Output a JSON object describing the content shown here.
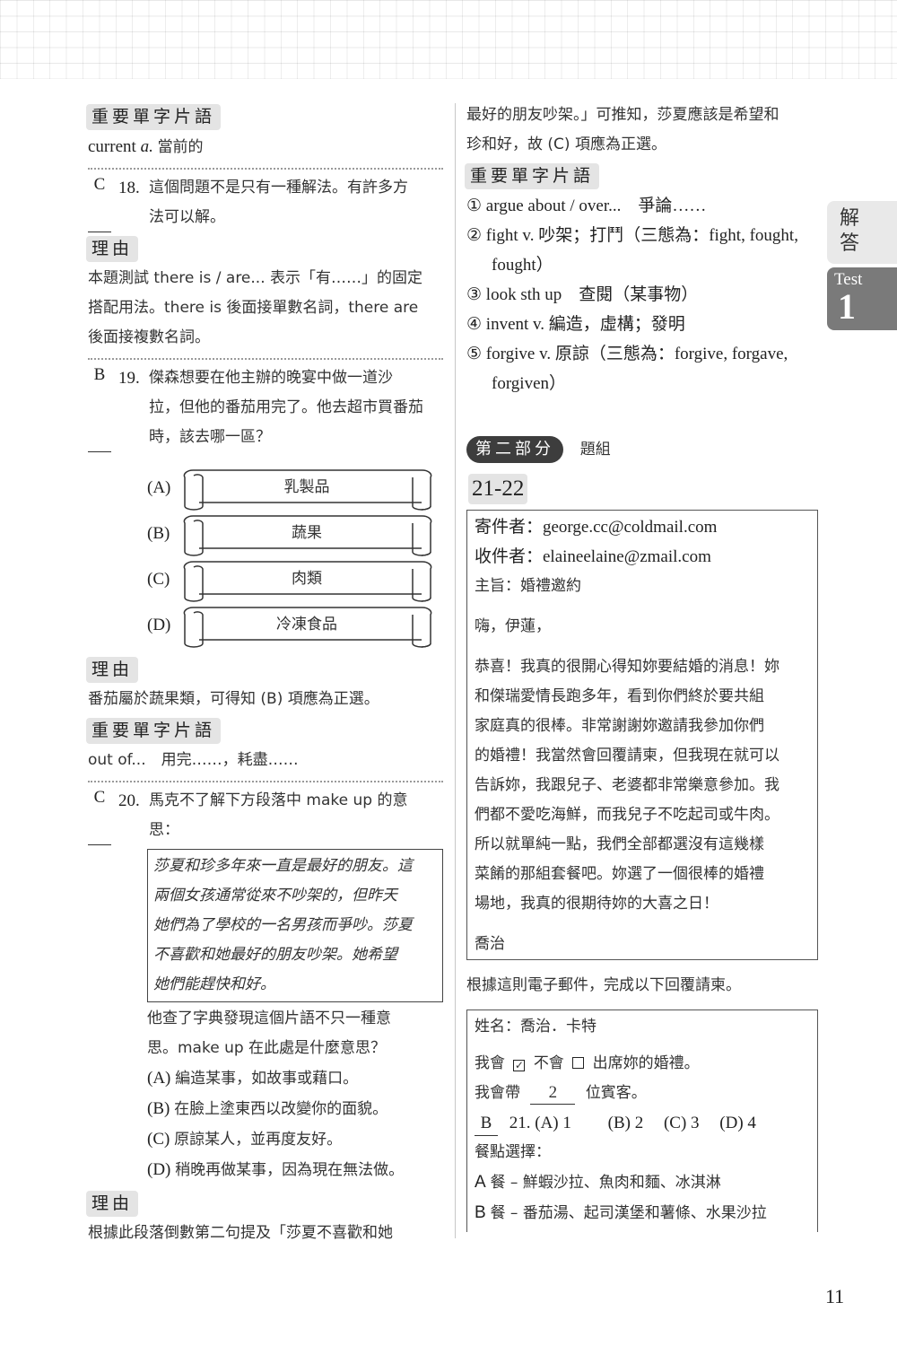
{
  "page_number": "11",
  "side_tabs": {
    "section": "解答",
    "test_label": "Test",
    "test_number": "1"
  },
  "labels": {
    "vocab": "重要單字片語",
    "reason": "理由"
  },
  "left": {
    "vocab1": {
      "word": "current",
      "pos": "a.",
      "meaning": "當前的"
    },
    "q18": {
      "answer": "C",
      "number": "18.",
      "text_lines": [
        "這個問題不是只有一種解法。有許多方",
        "法可以解。"
      ],
      "reason_lines": [
        "本題測試 there is / are... 表示「有……」的固定",
        "搭配用法。there is 後面接單數名詞，there are",
        "後面接複數名詞。"
      ]
    },
    "q19": {
      "answer": "B",
      "number": "19.",
      "text_lines": [
        "傑森想要在他主辦的晚宴中做一道沙",
        "拉，但他的番茄用完了。他去超市買番茄",
        "時，該去哪一區？"
      ],
      "options": [
        {
          "label": "(A)",
          "text": "乳製品"
        },
        {
          "label": "(B)",
          "text": "蔬果"
        },
        {
          "label": "(C)",
          "text": "肉類"
        },
        {
          "label": "(D)",
          "text": "冷凍食品"
        }
      ],
      "reason": "番茄屬於蔬果類，可得知 (B) 項應為正選。",
      "vocab": "out of...　用完……，耗盡……"
    },
    "q20": {
      "answer": "C",
      "number": "20.",
      "text_lines": [
        "馬克不了解下方段落中 make up 的意",
        "思："
      ],
      "passage_lines": [
        "莎夏和珍多年來一直是最好的朋友。這",
        "兩個女孩通常從來不吵架的，但昨天",
        "她們為了學校的一名男孩而爭吵。莎夏",
        "不喜歡和她最好的朋友吵架。她希望",
        "她們能趕快和好。"
      ],
      "followup_lines": [
        "他查了字典發現這個片語不只一種意",
        "思。make up 在此處是什麼意思？"
      ],
      "options": [
        {
          "label": "(A)",
          "text": "編造某事，如故事或藉口。"
        },
        {
          "label": "(B)",
          "text": "在臉上塗東西以改變你的面貌。"
        },
        {
          "label": "(C)",
          "text": "原諒某人，並再度友好。"
        },
        {
          "label": "(D)",
          "text": "稍晚再做某事，因為現在無法做。"
        }
      ],
      "reason_first_line": "根據此段落倒數第二句提及「莎夏不喜歡和她"
    }
  },
  "right": {
    "reason_cont_lines": [
      "最好的朋友吵架。」可推知，莎夏應該是希望和",
      "珍和好，故 (C) 項應為正選。"
    ],
    "vocab_items": [
      {
        "num": "①",
        "text": "argue about / over...　爭論……"
      },
      {
        "num": "②",
        "text": "fight v. 吵架；打鬥（三態為：fight, fought,",
        "cont": "fought）"
      },
      {
        "num": "③",
        "text": "look sth up　查閱（某事物）"
      },
      {
        "num": "④",
        "text": "invent v. 編造，虛構；發明"
      },
      {
        "num": "⑤",
        "text": "forgive v. 原諒（三態為：forgive, forgave,",
        "cont": "forgiven）"
      }
    ],
    "part_badge": "第二部分",
    "part_title": "題組",
    "group_number": "21-22",
    "email": {
      "from": "寄件者：george.cc@coldmail.com",
      "to": "收件者：elaineelaine@zmail.com",
      "subject": "主旨：婚禮邀約",
      "greeting": "嗨，伊蓮，",
      "body_lines": [
        "恭喜！我真的很開心得知妳要結婚的消息！妳",
        "和傑瑞愛情長跑多年，看到你們終於要共組",
        "家庭真的很棒。非常謝謝妳邀請我參加你們",
        "的婚禮！我當然會回覆請柬，但我現在就可以",
        "告訴妳，我跟兒子、老婆都非常樂意參加。我",
        "們都不愛吃海鮮，而我兒子不吃起司或牛肉。",
        "所以就單純一點，我們全部都選沒有這幾樣",
        "菜餚的那組套餐吧。妳選了一個很棒的婚禮",
        "場地，我真的很期待妳的大喜之日！"
      ],
      "signature": "喬治"
    },
    "instruction": "根據這則電子郵件，完成以下回覆請柬。",
    "rsvp": {
      "name": "姓名：喬治．卡特",
      "attend_prefix": "我會",
      "attend_yes_checked": true,
      "attend_mid": "不會",
      "attend_no_checked": false,
      "attend_suffix": "出席妳的婚禮。",
      "guests_prefix": "我會帶",
      "guests_value": "2",
      "guests_suffix": "位賓客。",
      "q21": {
        "answer": "B",
        "number": "21.",
        "options": [
          "(A) 1",
          "(B) 2",
          "(C) 3",
          "(D) 4"
        ]
      },
      "meal_label": "餐點選擇：",
      "meals": [
        {
          "code": "A",
          "text": "餐 – 鮮蝦沙拉、魚肉和麵、冰淇淋"
        },
        {
          "code": "B",
          "text": "餐 – 番茄湯、起司漢堡和薯條、水果沙拉"
        }
      ]
    }
  }
}
